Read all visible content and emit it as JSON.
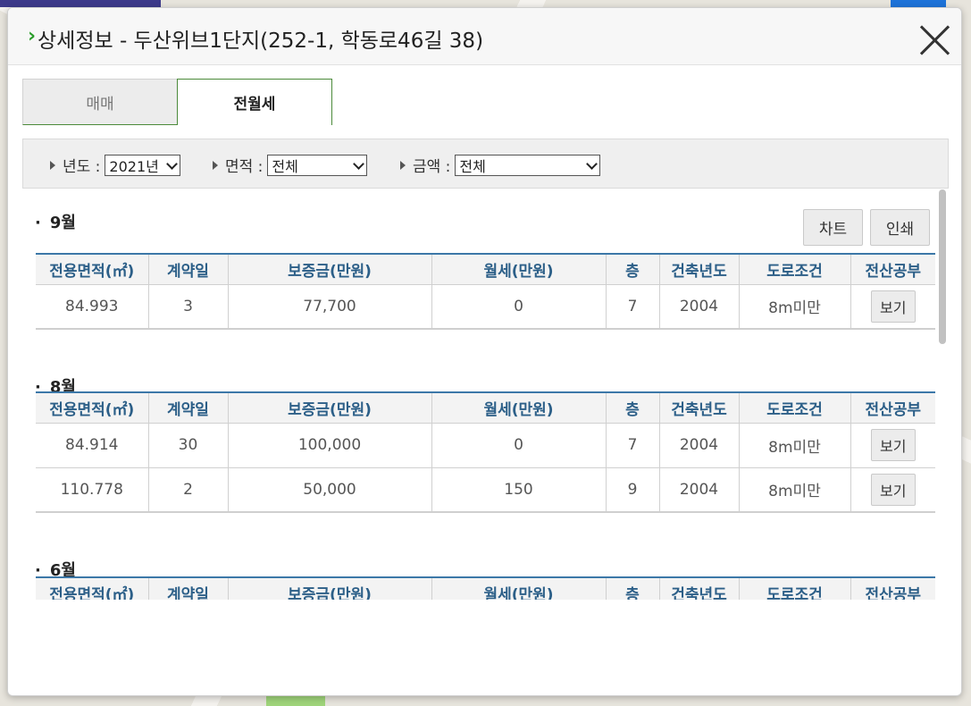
{
  "dialog": {
    "title": "상세정보 - 두산위브1단지(252-1, 학동로46길 38)"
  },
  "tabs": [
    {
      "label": "매매",
      "active": false
    },
    {
      "label": "전월세",
      "active": true
    }
  ],
  "filters": {
    "year": {
      "label": "년도 :",
      "value": "2021년"
    },
    "area": {
      "label": "면적 :",
      "value": "전체"
    },
    "price": {
      "label": "금액 :",
      "value": "전체"
    }
  },
  "buttons": {
    "chart": "차트",
    "print": "인쇄",
    "view": "보기"
  },
  "columns": [
    "전용면적(㎡)",
    "계약일",
    "보증금(만원)",
    "월세(만원)",
    "층",
    "건축년도",
    "도로조건",
    "전산공부"
  ],
  "sections": [
    {
      "month": "9월",
      "rows": [
        [
          "84.993",
          "3",
          "77,700",
          "0",
          "7",
          "2004",
          "8m미만"
        ]
      ]
    },
    {
      "month": "8월",
      "rows": [
        [
          "84.914",
          "30",
          "100,000",
          "0",
          "7",
          "2004",
          "8m미만"
        ],
        [
          "110.778",
          "2",
          "50,000",
          "150",
          "9",
          "2004",
          "8m미만"
        ]
      ]
    },
    {
      "month": "6월",
      "rows": []
    }
  ],
  "colors": {
    "accent": "#2a9d2a",
    "header_text": "#2c5f88",
    "table_top_border": "#3c78a8"
  }
}
